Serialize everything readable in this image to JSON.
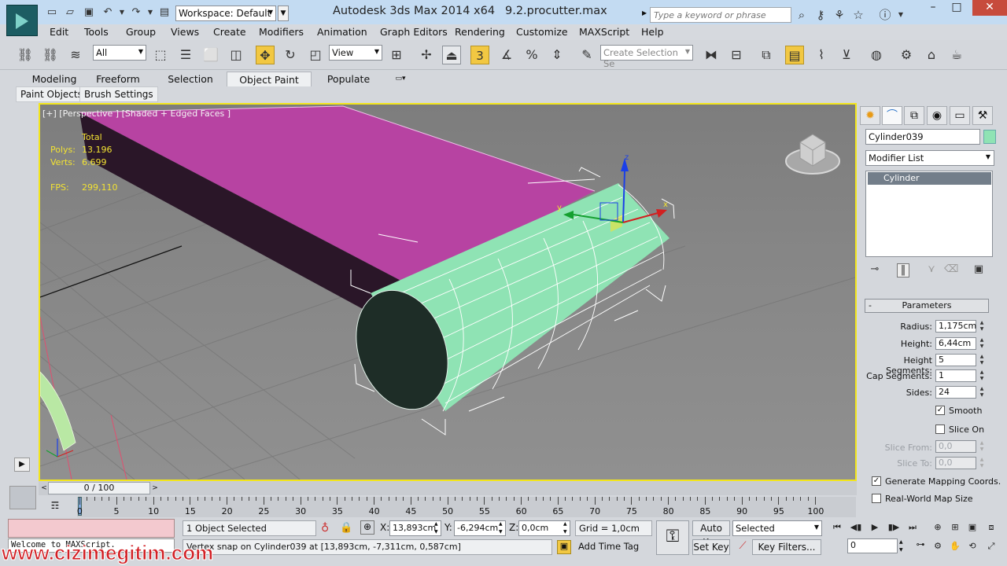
{
  "titlebar": {
    "workspace": "Workspace: Default",
    "app_title": "Autodesk 3ds Max  2014 x64",
    "doc_name": "9.2.procutter.max",
    "search_placeholder": "Type a keyword or phrase"
  },
  "menu": [
    "Edit",
    "Tools",
    "Group",
    "Views",
    "Create",
    "Modifiers",
    "Animation",
    "Graph Editors",
    "Rendering",
    "Customize",
    "MAXScript",
    "Help"
  ],
  "main_toolbar": {
    "selection_filter": "All",
    "ref_coord": "View",
    "snap_label": "3",
    "named_selection_placeholder": "Create Selection Se"
  },
  "ribbon": {
    "tabs": [
      "Modeling",
      "Freeform",
      "Selection",
      "Object Paint",
      "Populate"
    ],
    "active_tab": "Object Paint",
    "subtabs": [
      "Paint Objects",
      "Brush Settings"
    ]
  },
  "viewport": {
    "label": "[+] [Perspective ] [Shaded + Edged Faces ]",
    "stats": {
      "header": "Total",
      "polys_label": "Polys:",
      "polys": "13.196",
      "verts_label": "Verts:",
      "verts": "6.699",
      "fps_label": "FPS:",
      "fps": "299,110"
    },
    "gizmo_axes": {
      "x": "x",
      "y": "y",
      "z": "z"
    }
  },
  "command_panel": {
    "object_name": "Cylinder039",
    "object_color": "#8fe3b4",
    "modifier_list": "Modifier List",
    "stack_item": "Cylinder",
    "rollout": "Parameters",
    "params": [
      {
        "label": "Radius:",
        "value": "1,175cm"
      },
      {
        "label": "Height:",
        "value": "6,44cm"
      },
      {
        "label": "Height Segments:",
        "value": "5"
      },
      {
        "label": "Cap Segments:",
        "value": "1"
      },
      {
        "label": "Sides:",
        "value": "24"
      }
    ],
    "smooth": "Smooth",
    "slice_on": "Slice On",
    "slice_from_label": "Slice From:",
    "slice_from": "0,0",
    "slice_to_label": "Slice To:",
    "slice_to": "0,0",
    "gen_mapping": "Generate Mapping Coords.",
    "real_world": "Real-World Map Size"
  },
  "timeline": {
    "frame": "0 / 100",
    "ticks": [
      "0",
      "5",
      "10",
      "15",
      "20",
      "25",
      "30",
      "35",
      "40",
      "45",
      "50",
      "55",
      "60",
      "65",
      "70",
      "75",
      "80",
      "85",
      "90",
      "95",
      "100"
    ]
  },
  "status": {
    "listener": "Welcome to MAXScript.",
    "selected": "1 Object Selected",
    "prompt": "Vertex snap on Cylinder039 at [13,893cm, -7,311cm, 0,587cm]",
    "x_label": "X:",
    "x": "13,893cm",
    "y_label": "Y:",
    "y": "-6,294cm",
    "z_label": "Z:",
    "z": "0,0cm",
    "grid": "Grid = 1,0cm",
    "add_time_tag": "Add Time Tag",
    "auto_key": "Auto Key",
    "set_key": "Set Key",
    "key_mode": "Selected",
    "key_filters": "Key Filters...",
    "current_frame": "0"
  },
  "watermark": "www.cizimegitim.com"
}
